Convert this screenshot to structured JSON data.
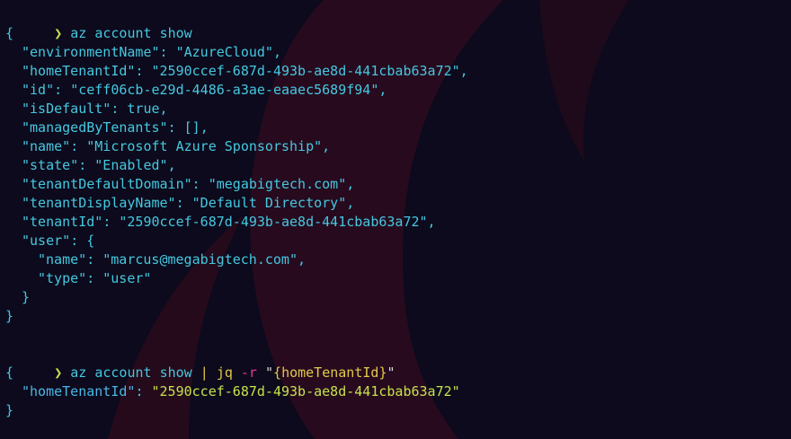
{
  "terminal": {
    "prompt_symbol": "❯",
    "commands": [
      {
        "text": "az account show"
      },
      {
        "base": "az account show",
        "pipe": "|",
        "program": "jq",
        "flag": "-r",
        "quote_open": "\"",
        "filter_open": "{",
        "filter_key": "homeTenantId",
        "filter_close": "}",
        "quote_close": "\""
      }
    ],
    "output1": {
      "open": "{",
      "close": "}",
      "lines": [
        {
          "key": "\"environmentName\"",
          "sep": ": ",
          "value": "\"AzureCloud\"",
          "end": ","
        },
        {
          "key": "\"homeTenantId\"",
          "sep": ": ",
          "value": "\"2590ccef-687d-493b-ae8d-441cbab63a72\"",
          "end": ","
        },
        {
          "key": "\"id\"",
          "sep": ": ",
          "value": "\"ceff06cb-e29d-4486-a3ae-eaaec5689f94\"",
          "end": ","
        },
        {
          "key": "\"isDefault\"",
          "sep": ": ",
          "value": "true",
          "end": ","
        },
        {
          "key": "\"managedByTenants\"",
          "sep": ": ",
          "value": "[]",
          "end": ","
        },
        {
          "key": "\"name\"",
          "sep": ": ",
          "value": "\"Microsoft Azure Sponsorship\"",
          "end": ","
        },
        {
          "key": "\"state\"",
          "sep": ": ",
          "value": "\"Enabled\"",
          "end": ","
        },
        {
          "key": "\"tenantDefaultDomain\"",
          "sep": ": ",
          "value": "\"megabigtech.com\"",
          "end": ","
        },
        {
          "key": "\"tenantDisplayName\"",
          "sep": ": ",
          "value": "\"Default Directory\"",
          "end": ","
        },
        {
          "key": "\"tenantId\"",
          "sep": ": ",
          "value": "\"2590ccef-687d-493b-ae8d-441cbab63a72\"",
          "end": ","
        }
      ],
      "user": {
        "key": "\"user\"",
        "sep": ": ",
        "open": "{",
        "close": "}",
        "lines": [
          {
            "key": "\"name\"",
            "sep": ": ",
            "value": "\"marcus@megabigtech.com\"",
            "end": ","
          },
          {
            "key": "\"type\"",
            "sep": ": ",
            "value": "\"user\"",
            "end": ""
          }
        ]
      }
    },
    "output2": {
      "open": "{",
      "close": "}",
      "key": "\"homeTenantId\"",
      "sep": ": ",
      "value": "\"2590ccef-687d-493b-ae8d-441cbab63a72\""
    }
  },
  "colors": {
    "background": "#0c0a1c",
    "swirl": "#3a0f24",
    "prompt": "#c6e24c",
    "cyan": "#45c8e0",
    "yellow": "#e3c94a",
    "magenta": "#e83a9a",
    "green": "#c6e24c"
  }
}
